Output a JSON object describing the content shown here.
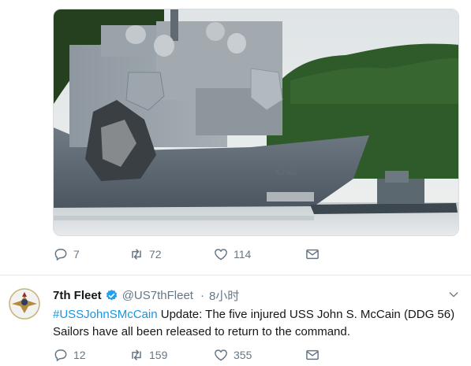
{
  "top_tweet": {
    "actions": {
      "reply_count": "7",
      "retweet_count": "72",
      "like_count": "114"
    }
  },
  "tweet": {
    "name": "7th Fleet",
    "handle": "@US7thFleet",
    "separator": "·",
    "time": "8小时",
    "hashtag": "#USSJohnSMcCain",
    "text_line1": " Update: The five injured USS John S. McCain (DDG 56)",
    "text_line2": "Sailors have all been released to return to the command.",
    "actions": {
      "reply_count": "12",
      "retweet_count": "159",
      "like_count": "355"
    }
  },
  "colors": {
    "link": "#1b95e0",
    "muted": "#657786",
    "divider": "#e1e8ed",
    "verified": "#1da1f2"
  },
  "icons": [
    "reply-icon",
    "retweet-icon",
    "like-icon",
    "dm-icon",
    "verified-icon",
    "chevron-down-icon"
  ]
}
